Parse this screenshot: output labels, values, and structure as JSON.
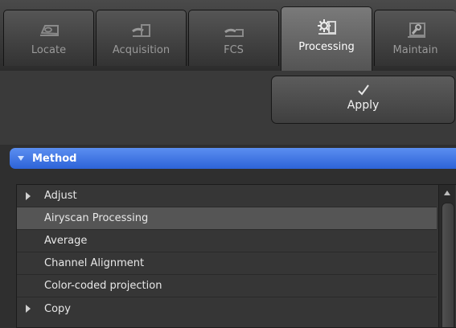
{
  "tabs": [
    {
      "label": "Locate",
      "icon": "locate-icon"
    },
    {
      "label": "Acquisition",
      "icon": "acquisition-icon"
    },
    {
      "label": "FCS",
      "icon": "fcs-icon"
    },
    {
      "label": "Processing",
      "icon": "processing-gear-icon"
    },
    {
      "label": "Maintain",
      "icon": "maintain-wrench-icon"
    }
  ],
  "active_tab": "Processing",
  "apply": {
    "label": "Apply",
    "icon": "checkmark-icon"
  },
  "method": {
    "title": "Method",
    "state": "expanded",
    "color": "#3a72e0"
  },
  "list": {
    "items": [
      {
        "label": "Adjust",
        "expandable": true,
        "selected": false
      },
      {
        "label": "Airyscan Processing",
        "expandable": false,
        "selected": true
      },
      {
        "label": "Average",
        "expandable": false,
        "selected": false
      },
      {
        "label": "Channel Alignment",
        "expandable": false,
        "selected": false
      },
      {
        "label": "Color-coded projection",
        "expandable": false,
        "selected": false
      },
      {
        "label": "Copy",
        "expandable": true,
        "selected": false
      }
    ]
  }
}
